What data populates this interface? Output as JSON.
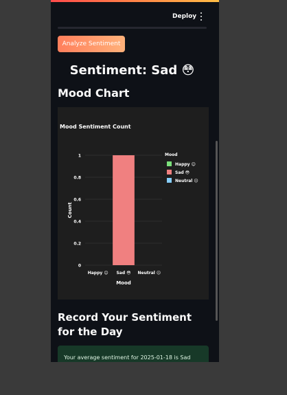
{
  "header": {
    "deploy_label": "Deploy",
    "menu_icon": "kebab-menu-icon"
  },
  "actions": {
    "analyze_label": "Analyze Sentiment"
  },
  "sentiment": {
    "title": "Sentiment: Sad 😳"
  },
  "mood": {
    "section_title": "Mood Chart"
  },
  "record": {
    "title": "Record Your Sentiment for the Day",
    "message": "Your average sentiment for 2025-01-18 is Sad"
  },
  "colors": {
    "happy": "#7be07b",
    "sad": "#f08080",
    "neutral": "#87cefa",
    "gradient_start": "#ff7f5c",
    "gradient_end": "#ffb17a"
  },
  "chart_data": {
    "type": "bar",
    "title": "Mood Sentiment Count",
    "xlabel": "Mood",
    "ylabel": "Count",
    "categories": [
      "Happy 😊",
      "Sad 😳",
      "Neutral 😐"
    ],
    "values": [
      0,
      1,
      0
    ],
    "ylim": [
      0,
      1
    ],
    "yticks": [
      "0",
      "0.2",
      "0.4",
      "0.6",
      "0.8",
      "1"
    ],
    "legend_title": "Mood",
    "legend": [
      "Happy 😊",
      "Sad 😳",
      "Neutral 😐"
    ],
    "legend_placement": "top-right",
    "grid": true
  }
}
